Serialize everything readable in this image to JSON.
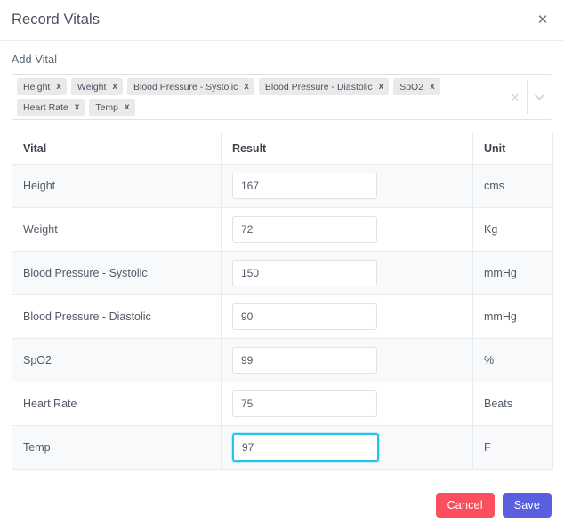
{
  "dialog": {
    "title": "Record Vitals",
    "close_icon": "close-icon"
  },
  "add_vital": {
    "label": "Add Vital",
    "chips": [
      {
        "label": "Height",
        "remove_icon": "x"
      },
      {
        "label": "Weight",
        "remove_icon": "x"
      },
      {
        "label": "Blood Pressure - Systolic",
        "remove_icon": "x"
      },
      {
        "label": "Blood Pressure - Diastolic",
        "remove_icon": "x"
      },
      {
        "label": "SpO2",
        "remove_icon": "x"
      },
      {
        "label": "Heart Rate",
        "remove_icon": "x"
      },
      {
        "label": "Temp",
        "remove_icon": "x"
      }
    ],
    "clear_icon": "clear-x-icon",
    "caret_icon": "chevron-down-icon"
  },
  "table": {
    "columns": [
      "Vital",
      "Result",
      "Unit"
    ],
    "rows": [
      {
        "vital": "Height",
        "result": "167",
        "unit": "cms",
        "focused": false
      },
      {
        "vital": "Weight",
        "result": "72",
        "unit": "Kg",
        "focused": false
      },
      {
        "vital": "Blood Pressure - Systolic",
        "result": "150",
        "unit": "mmHg",
        "focused": false
      },
      {
        "vital": "Blood Pressure - Diastolic",
        "result": "90",
        "unit": "mmHg",
        "focused": false
      },
      {
        "vital": "SpO2",
        "result": "99",
        "unit": "%",
        "focused": false
      },
      {
        "vital": "Heart Rate",
        "result": "75",
        "unit": "Beats",
        "focused": false
      },
      {
        "vital": "Temp",
        "result": "97",
        "unit": "F",
        "focused": true
      }
    ]
  },
  "footer": {
    "cancel_label": "Cancel",
    "save_label": "Save"
  },
  "colors": {
    "cancel": "#fb4e5e",
    "save": "#5a5fe0",
    "focus_border": "#22c8e6",
    "chip_bg": "#eaeaea",
    "row_stripe": "#f7f9fa"
  }
}
